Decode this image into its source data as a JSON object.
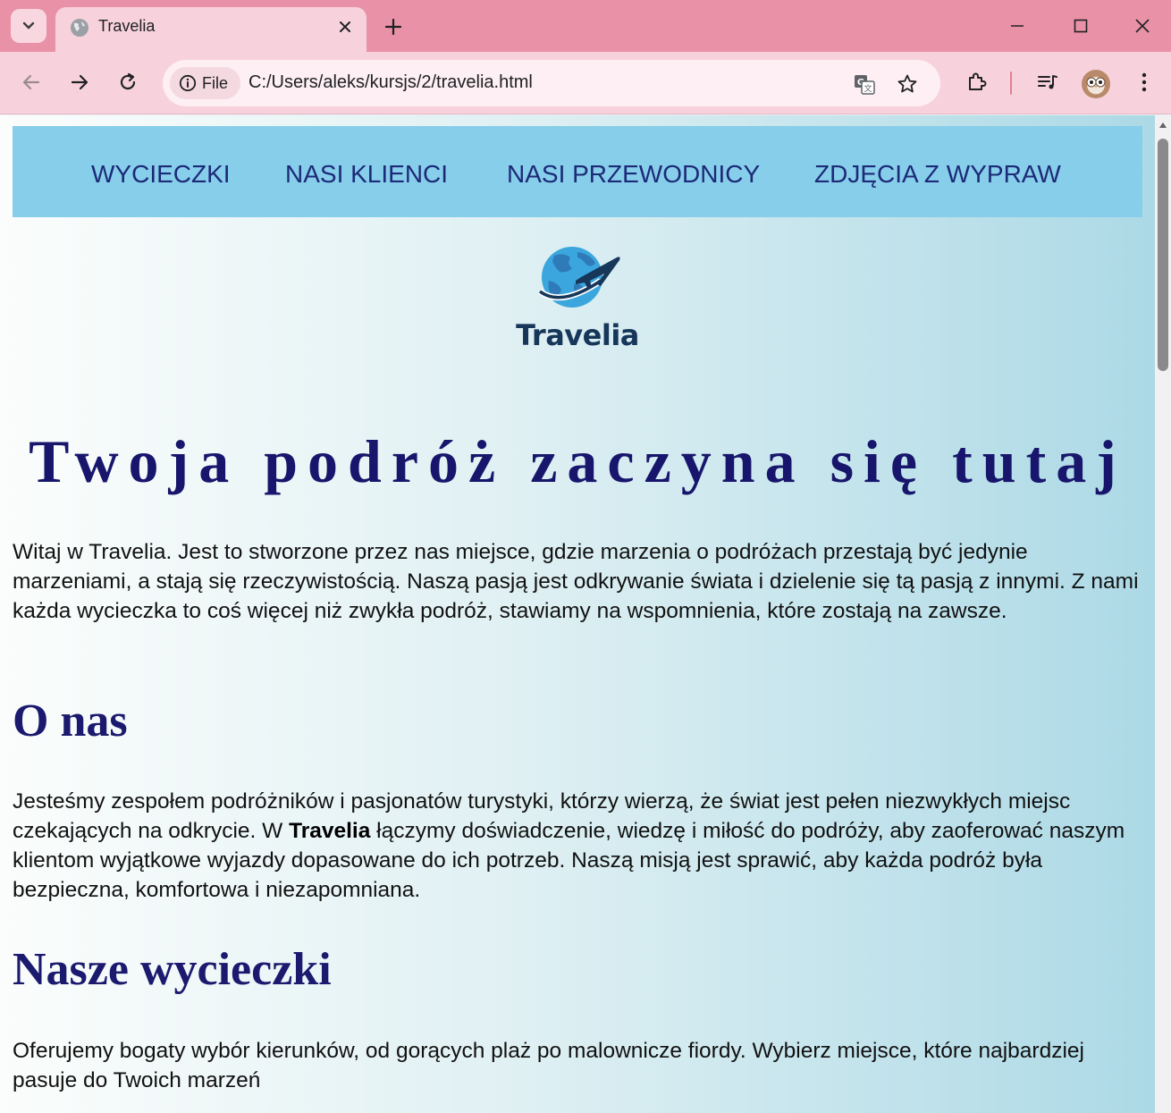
{
  "browser": {
    "tab_title": "Travelia",
    "file_chip": "File",
    "url": "C:/Users/aleks/kursjs/2/travelia.html"
  },
  "site": {
    "nav": [
      "WYCIECZKI",
      "NASI KLIENCI",
      "NASI PRZEWODNICY",
      "ZDJĘCIA Z WYPRAW"
    ],
    "logo_text": "Travelia",
    "hero_title": "Twoja podróż zaczyna się tutaj",
    "intro": "Witaj w Travelia. Jest to stworzone przez nas miejsce, gdzie marzenia o podróżach przestają być jedynie marzeniami, a stają się rzeczywistością. Naszą pasją jest odkrywanie świata i dzielenie się tą pasją z innymi. Z nami każda wycieczka to coś więcej niż zwykła podróż, stawiamy na wspomnienia, które zostają na zawsze.",
    "about": {
      "heading": "O nas",
      "text_before": "Jesteśmy zespołem podróżników i pasjonatów turystyki, którzy wierzą, że świat jest pełen niezwykłych miejsc czekających na odkrycie. W ",
      "brand": "Travelia",
      "text_after": " łączymy doświadczenie, wiedzę i miłość do podróży, aby zaoferować naszym klientom wyjątkowe wyjazdy dopasowane do ich potrzeb. Naszą misją jest sprawić, aby każda podróż była bezpieczna, komfortowa i niezapomniana."
    },
    "trips": {
      "heading": "Nasze wycieczki",
      "text": "Oferujemy bogaty wybór kierunków, od gorących plaż po malownicze fiordy. Wybierz miejsce, które najbardziej pasuje do Twoich marzeń"
    }
  },
  "colors": {
    "titlebar": "#e991a6",
    "toolbar": "#f7d2dc",
    "nav_bg": "#87ceea",
    "nav_text": "#1c2a78",
    "heading": "#17166c",
    "logo_text": "#16365a"
  }
}
